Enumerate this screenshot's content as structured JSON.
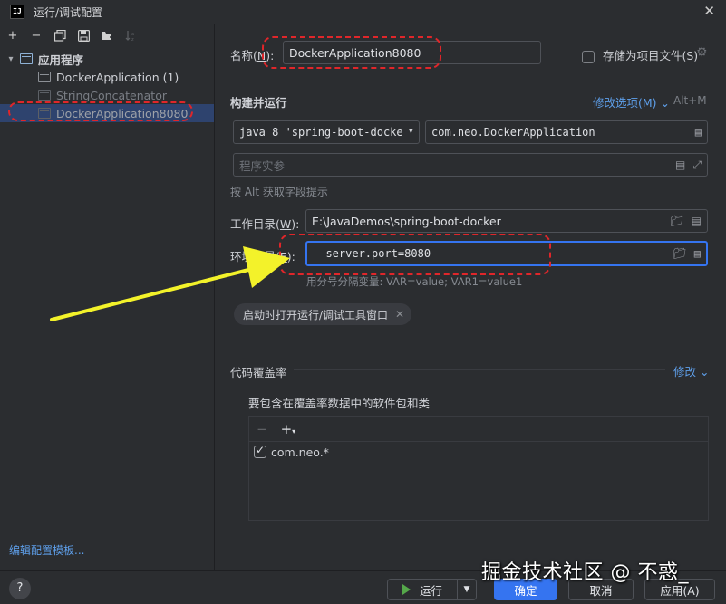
{
  "window": {
    "title": "运行/调试配置",
    "logo_text": "IJ"
  },
  "left": {
    "tree": {
      "group_label": "应用程序",
      "items": [
        {
          "label": "DockerApplication (1)"
        },
        {
          "label": "StringConcatenator"
        },
        {
          "label": "DockerApplication8080"
        }
      ]
    },
    "edit_templates_link": "编辑配置模板..."
  },
  "form": {
    "name_label_prefix": "名称(",
    "name_label_key": "N",
    "name_label_suffix": "):",
    "name_value": "DockerApplication8080",
    "store_as_project_file": "存储为项目文件(S)",
    "build_run_title": "构建并运行",
    "modify_options_link": "修改选项(M)",
    "modify_options_shortcut": "Alt+M",
    "jdk_select": "java 8 'spring-boot-docke",
    "main_class": "com.neo.DockerApplication",
    "program_args_placeholder": "程序实参",
    "alt_hint": "按 Alt 获取字段提示",
    "workdir_label_prefix": "工作目录(",
    "workdir_label_key": "W",
    "workdir_label_suffix": "):",
    "workdir_value": "E:\\JavaDemos\\spring-boot-docker",
    "env_label_prefix": "环境变量(",
    "env_label_key": "E",
    "env_label_suffix": "):",
    "env_value": "--server.port=8080",
    "env_hint": "用分号分隔变量: VAR=value; VAR1=value1",
    "chip_label": "启动时打开运行/调试工具窗口",
    "coverage_title": "代码覆盖率",
    "coverage_modify_link": "修改",
    "coverage_packages_label": "要包含在覆盖率数据中的软件包和类",
    "packages": [
      {
        "name": "com.neo.*",
        "checked": true
      }
    ]
  },
  "buttons": {
    "help": "?",
    "run": "运行",
    "ok": "确定",
    "cancel": "取消",
    "apply": "应用(A)"
  },
  "watermark": "掘金技术社区 @ 不惑_",
  "colors": {
    "accent": "#3574f0",
    "link": "#5e9fea",
    "annotation_red": "#e0262a",
    "annotation_arrow": "#f3f22a"
  }
}
